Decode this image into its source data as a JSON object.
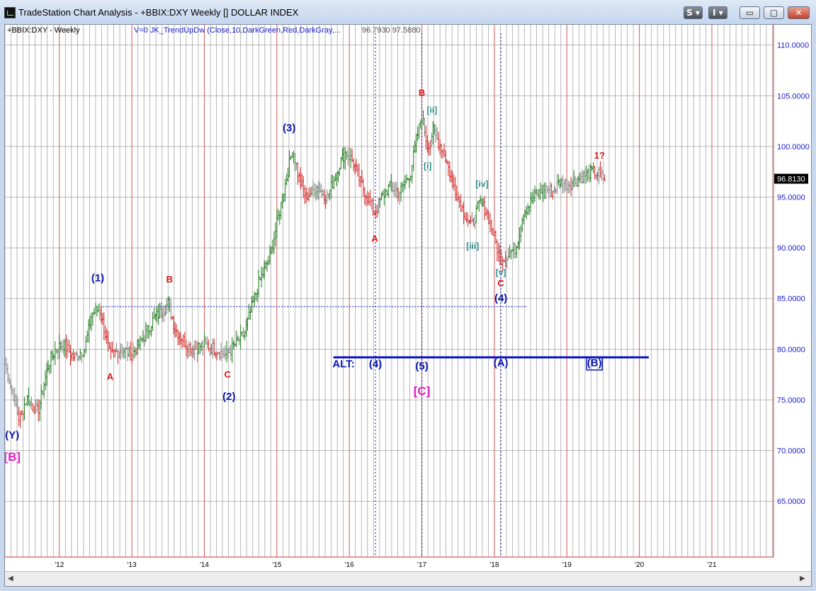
{
  "window": {
    "title": "TradeStation Chart Analysis - +BBIX:DXY Weekly [] DOLLAR INDEX",
    "buttons": {
      "s": "S ▾",
      "i": "I ▾",
      "min": "▭",
      "max": "▢",
      "close": "✕"
    }
  },
  "header": {
    "symbol": "+BBIX:DXY - Weekly",
    "indicator": "V=0  JK_TrendUpDw (Close,10,DarkGreen,Red,DarkGray,...",
    "values": "96.7930  97.5880"
  },
  "colors": {
    "up": "#1c7a1c",
    "down": "#d22020",
    "neutral": "#808080",
    "grid": "#808080",
    "navy": "#0b17b4",
    "red": "#e01010",
    "teal": "#2b8c88",
    "magenta": "#e020c0",
    "axis": "#cc3333"
  },
  "chart_data": {
    "type": "ohlc",
    "title": "",
    "xlabel": "",
    "ylabel": "",
    "ylim": [
      59.5,
      112.0
    ],
    "y_ticks": [
      "110.0000",
      "105.0000",
      "100.0000",
      "95.0000",
      "90.0000",
      "85.0000",
      "80.0000",
      "75.0000",
      "70.0000",
      "65.0000"
    ],
    "y_tick_values": [
      110,
      105,
      100,
      95,
      90,
      85,
      80,
      75,
      70,
      65
    ],
    "x_ticks": [
      "'12",
      "'13",
      "'14",
      "'15",
      "'16",
      "'17",
      "'18",
      "'19",
      "'20",
      "'21"
    ],
    "x_tick_years": [
      2012,
      2013,
      2014,
      2015,
      2016,
      2017,
      2018,
      2019,
      2020,
      2021
    ],
    "xlim": [
      2011.25,
      2021.85
    ],
    "last_price": "96.8130",
    "last_value": 96.813,
    "price_path": [
      [
        2011.25,
        78.5
      ],
      [
        2011.4,
        74.5
      ],
      [
        2011.45,
        73.0
      ],
      [
        2011.55,
        75.2
      ],
      [
        2011.7,
        73.8
      ],
      [
        2011.85,
        78.5
      ],
      [
        2011.95,
        80.0
      ],
      [
        2012.05,
        80.5
      ],
      [
        2012.2,
        79.2
      ],
      [
        2012.35,
        80.0
      ],
      [
        2012.45,
        83.5
      ],
      [
        2012.55,
        84.0
      ],
      [
        2012.62,
        82.0
      ],
      [
        2012.7,
        79.3
      ],
      [
        2012.85,
        80.0
      ],
      [
        2013.0,
        79.5
      ],
      [
        2013.15,
        81.0
      ],
      [
        2013.3,
        83.0
      ],
      [
        2013.45,
        84.0
      ],
      [
        2013.5,
        84.5
      ],
      [
        2013.6,
        82.0
      ],
      [
        2013.75,
        80.5
      ],
      [
        2013.85,
        80.0
      ],
      [
        2014.0,
        80.5
      ],
      [
        2014.15,
        80.0
      ],
      [
        2014.3,
        79.4
      ],
      [
        2014.4,
        80.2
      ],
      [
        2014.55,
        81.5
      ],
      [
        2014.75,
        86.5
      ],
      [
        2014.9,
        89.0
      ],
      [
        2015.05,
        94.0
      ],
      [
        2015.15,
        97.5
      ],
      [
        2015.22,
        99.8
      ],
      [
        2015.3,
        97.0
      ],
      [
        2015.4,
        95.0
      ],
      [
        2015.55,
        96.0
      ],
      [
        2015.7,
        95.0
      ],
      [
        2015.85,
        98.0
      ],
      [
        2015.95,
        99.5
      ],
      [
        2016.05,
        98.5
      ],
      [
        2016.15,
        96.5
      ],
      [
        2016.25,
        95.0
      ],
      [
        2016.35,
        93.5
      ],
      [
        2016.45,
        95.0
      ],
      [
        2016.55,
        96.0
      ],
      [
        2016.7,
        95.5
      ],
      [
        2016.85,
        97.5
      ],
      [
        2016.92,
        100.5
      ],
      [
        2017.0,
        103.0
      ],
      [
        2017.08,
        100.0
      ],
      [
        2017.15,
        101.5
      ],
      [
        2017.3,
        99.5
      ],
      [
        2017.4,
        97.0
      ],
      [
        2017.55,
        94.0
      ],
      [
        2017.68,
        92.0
      ],
      [
        2017.8,
        94.5
      ],
      [
        2017.9,
        93.5
      ],
      [
        2018.0,
        91.0
      ],
      [
        2018.08,
        88.8
      ],
      [
        2018.2,
        89.5
      ],
      [
        2018.3,
        90.0
      ],
      [
        2018.4,
        93.5
      ],
      [
        2018.55,
        95.0
      ],
      [
        2018.7,
        96.0
      ],
      [
        2018.8,
        95.5
      ],
      [
        2018.9,
        96.5
      ],
      [
        2019.0,
        96.3
      ],
      [
        2019.1,
        96.5
      ],
      [
        2019.2,
        97.0
      ],
      [
        2019.35,
        97.5
      ],
      [
        2019.45,
        97.2
      ],
      [
        2019.52,
        96.8
      ]
    ],
    "reference_lines": [
      {
        "kind": "dotted-horizontal",
        "y": 84.2,
        "x_from": 2012.6,
        "x_to": 2018.45
      },
      {
        "kind": "solid-horizontal",
        "y": 79.2,
        "x_from": 2015.78,
        "x_to": 2020.13
      },
      {
        "kind": "dotted-vertical",
        "x": 2016.36
      },
      {
        "kind": "dotted-vertical",
        "x": 2017.0
      },
      {
        "kind": "dotted-vertical",
        "x": 2018.09
      }
    ],
    "annotations": [
      {
        "text": "(Y)",
        "x": 2011.35,
        "y": 71.2,
        "color": "navy"
      },
      {
        "text": "[B]",
        "x": 2011.35,
        "y": 69.0,
        "color": "magenta"
      },
      {
        "text": "(1)",
        "x": 2012.53,
        "y": 86.7,
        "color": "navy"
      },
      {
        "text": "A",
        "x": 2012.7,
        "y": 77.0,
        "color": "red"
      },
      {
        "text": "B",
        "x": 2013.52,
        "y": 86.6,
        "color": "red"
      },
      {
        "text": "C",
        "x": 2014.32,
        "y": 77.2,
        "color": "red"
      },
      {
        "text": "(2)",
        "x": 2014.34,
        "y": 75.0,
        "color": "navy"
      },
      {
        "text": "(3)",
        "x": 2015.17,
        "y": 101.5,
        "color": "navy"
      },
      {
        "text": "A",
        "x": 2016.35,
        "y": 90.6,
        "color": "red"
      },
      {
        "text": "B",
        "x": 2017.0,
        "y": 105.0,
        "color": "red"
      },
      {
        "text": "[ii]",
        "x": 2017.14,
        "y": 103.3,
        "color": "teal"
      },
      {
        "text": "[i]",
        "x": 2017.08,
        "y": 97.8,
        "color": "teal"
      },
      {
        "text": "[iv]",
        "x": 2017.83,
        "y": 96.0,
        "color": "teal"
      },
      {
        "text": "[iii]",
        "x": 2017.7,
        "y": 89.9,
        "color": "teal"
      },
      {
        "text": "[v]",
        "x": 2018.09,
        "y": 87.3,
        "color": "teal"
      },
      {
        "text": "C",
        "x": 2018.09,
        "y": 86.2,
        "color": "red"
      },
      {
        "text": "(4)",
        "x": 2018.09,
        "y": 84.7,
        "color": "navy"
      },
      {
        "text": "1?",
        "x": 2019.45,
        "y": 98.8,
        "color": "red"
      },
      {
        "text": "ALT:",
        "x": 2015.92,
        "y": 78.2,
        "color": "navy"
      },
      {
        "text": "(4)",
        "x": 2016.36,
        "y": 78.2,
        "color": "navy"
      },
      {
        "text": "(5)",
        "x": 2017.0,
        "y": 78.0,
        "color": "navy"
      },
      {
        "text": "[C]",
        "x": 2017.0,
        "y": 75.5,
        "color": "magenta"
      },
      {
        "text": "(A)",
        "x": 2018.09,
        "y": 78.3,
        "color": "navy"
      },
      {
        "text": "(B)",
        "x": 2019.38,
        "y": 78.3,
        "color": "navy",
        "boxed": true
      }
    ]
  }
}
